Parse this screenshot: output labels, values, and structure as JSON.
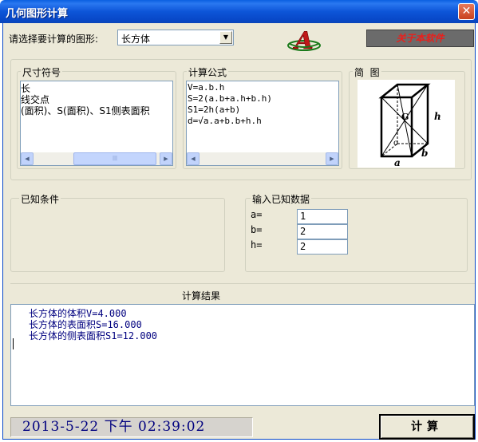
{
  "window": {
    "title": "几何图形计算",
    "close_glyph": "✕"
  },
  "select_label": "请选择要计算的图形:",
  "shape_select": {
    "value": "长方体"
  },
  "about_button": "关于本软件",
  "logo_letter": "A",
  "dimensions_panel": {
    "title": "尺寸符号",
    "lines": [
      "长",
      "线交点",
      "(面积)、S(面积)、S1侧表面积"
    ]
  },
  "formula_panel": {
    "title": "计算公式",
    "lines": [
      "V=a.b.h",
      "S=2(a.b+a.h+b.h)",
      "S1=2h(a+b)",
      "d=√a.a+b.b+h.h"
    ]
  },
  "diagram_panel": {
    "title": "简  图",
    "labels": {
      "h": "h",
      "a": "a",
      "b": "b",
      "g": "G",
      "o": "o"
    }
  },
  "known_conditions": {
    "title": "已知条件"
  },
  "input_data": {
    "title": "输入已知数据",
    "fields": [
      {
        "label": "a=",
        "value": "1"
      },
      {
        "label": "b=",
        "value": "2"
      },
      {
        "label": "h=",
        "value": "2"
      }
    ]
  },
  "results": {
    "title": "计算结果",
    "lines": [
      "长方体的体积V=4.000",
      "长方体的表面积S=16.000",
      "长方体的侧表面积S1=12.000"
    ]
  },
  "datetime": "2013-5-22  下午  02:39:02",
  "calculate_button": "计算",
  "scrollbar_glyphs": {
    "left": "◀",
    "right": "▶",
    "thumb": "|||"
  }
}
